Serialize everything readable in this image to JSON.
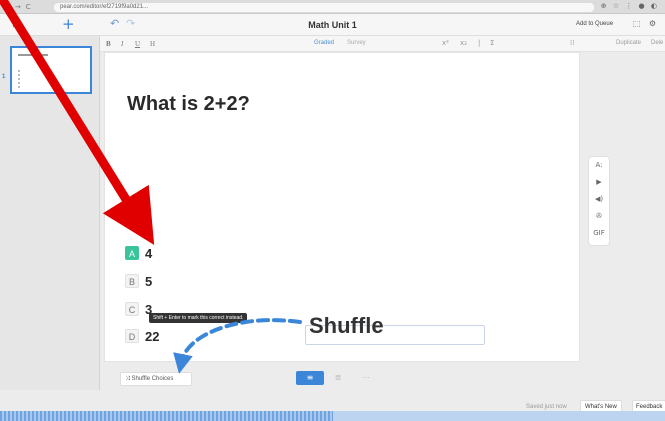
{
  "browser": {
    "url": "pear.com/editor/ef2719f9a0d21...",
    "nav_icons": [
      "←",
      "→",
      "C"
    ],
    "ext_icons": "⊕ ☆ ⋮ ● ◐"
  },
  "header": {
    "grid_icon": "▦",
    "add_slide": "+",
    "undo": "↶",
    "redo": "↷",
    "title": "Math Unit 1",
    "add_to_queue": "Add to Queue",
    "icons": "⬚ ⚙"
  },
  "toolbar": {
    "bold": "B",
    "italic": "I",
    "underline": "U",
    "heading": "H",
    "graded": "Graded",
    "survey": "Survey",
    "superscript": "x²",
    "subscript": "x₂",
    "divider": "|",
    "sigma": "Σ",
    "grid": "⁞⁞",
    "duplicate": "Duplicate",
    "delete": "Dele"
  },
  "sidebar": {
    "slides": [
      {
        "number": "1"
      }
    ]
  },
  "question": {
    "text": "What is 2+2?"
  },
  "answers": [
    {
      "letter": "A",
      "text": "4",
      "correct": true
    },
    {
      "letter": "B",
      "text": "5",
      "correct": false
    },
    {
      "letter": "C",
      "text": "3",
      "correct": false
    },
    {
      "letter": "D",
      "text": "22",
      "correct": false
    }
  ],
  "tooltip": "Shift + Enter to mark this correct instead.",
  "media_tools": [
    "A:",
    "▶",
    "◀)",
    "✇",
    "GIF"
  ],
  "shuffle_button": "⤨ Shuffle Choices",
  "layout_buttons": [
    "≡",
    "≣",
    "⋯"
  ],
  "footer": {
    "saved": "Saved just now",
    "whats_new": "What's New",
    "feedback": "Feedback"
  },
  "progress": 0.5,
  "annotation": {
    "label": "Shuffle",
    "arrow_color": "#e00000",
    "dash_color": "#3b86d8"
  },
  "colors": {
    "accent": "#3b86d8",
    "correct": "#39c49b"
  }
}
